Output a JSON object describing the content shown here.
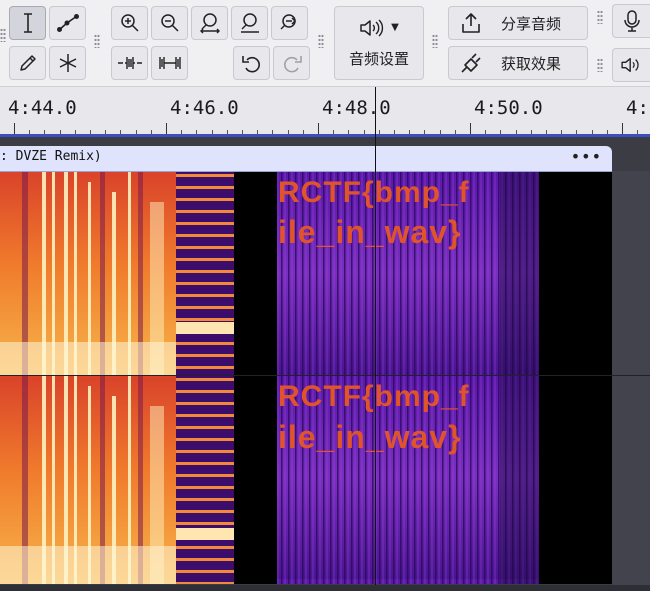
{
  "toolbar": {
    "share_audio_label": "分享音频",
    "get_effects_label": "获取效果",
    "audio_settings_label": "音频设置"
  },
  "ruler": {
    "ticks": [
      "4:44.0",
      "4:46.0",
      "4:48.0",
      "4:50.0",
      "4:"
    ]
  },
  "track": {
    "clip_name": ": DVZE Remix)",
    "clip_menu": "•••"
  },
  "spectrogram": {
    "hidden_text_line1": "RCTF{bmp_f",
    "hidden_text_line2": "ile_in_wav}"
  },
  "icons": {
    "select": "i-beam-cursor-icon",
    "envelope": "envelope-tool-icon",
    "draw": "pencil-icon",
    "multi": "multi-tool-icon",
    "zoom_in": "zoom-in-icon",
    "zoom_out": "zoom-out-icon",
    "fit_selection": "zoom-fit-selection-icon",
    "fit_project": "zoom-fit-project-icon",
    "zoom_toggle": "zoom-toggle-icon",
    "trim": "trim-audio-icon",
    "silence": "silence-audio-icon",
    "undo": "undo-icon",
    "redo": "redo-icon",
    "audio_setup": "speaker-icon",
    "share": "share-upload-icon",
    "effects": "plug-icon",
    "record_meter": "microphone-icon",
    "playback_meter": "speaker-icon"
  },
  "colors": {
    "accent": "#3d4fc0",
    "clip_header": "#dfe3fb",
    "hidden_text": "#e0542c"
  }
}
